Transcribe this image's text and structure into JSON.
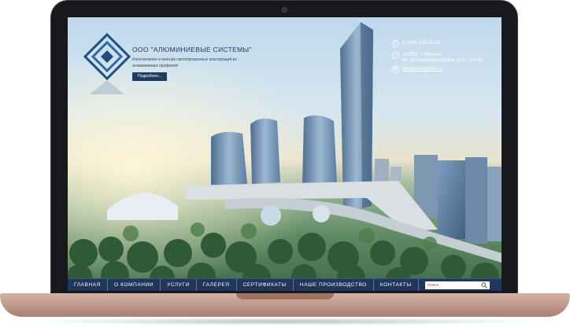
{
  "header": {
    "company_name": "ООО \"АЛЮМИНИЕВЫЕ СИСТЕМЫ\"",
    "tagline": "Изготовление и монтаж светопрозрачных конструкций из алюминиевых профилей",
    "more_button": "Подробнее..."
  },
  "contacts": {
    "phone": "8 (499) 678-02-15",
    "address_line1": "121351, г. Москва,",
    "address_line2": "ул. Молодогвардейская, д.61, стр.32",
    "email": "info@al-systems.ru"
  },
  "nav": {
    "items": [
      "ГЛАВНАЯ",
      "О КОМПАНИИ",
      "УСЛУГИ",
      "ГАЛЕРЕЯ",
      "СЕРТИФИКАТЫ",
      "НАШЕ ПРОИЗВОДСТВО",
      "КОНТАКТЫ"
    ]
  },
  "search": {
    "placeholder": "поиск..."
  },
  "colors": {
    "nav_bg": "#20365a",
    "brand_blue": "#1d3c63",
    "laptop_base": "#c4a191"
  },
  "icons": {
    "phone": "phone-icon",
    "address": "location-icon",
    "email": "mail-icon",
    "search": "search-icon"
  }
}
